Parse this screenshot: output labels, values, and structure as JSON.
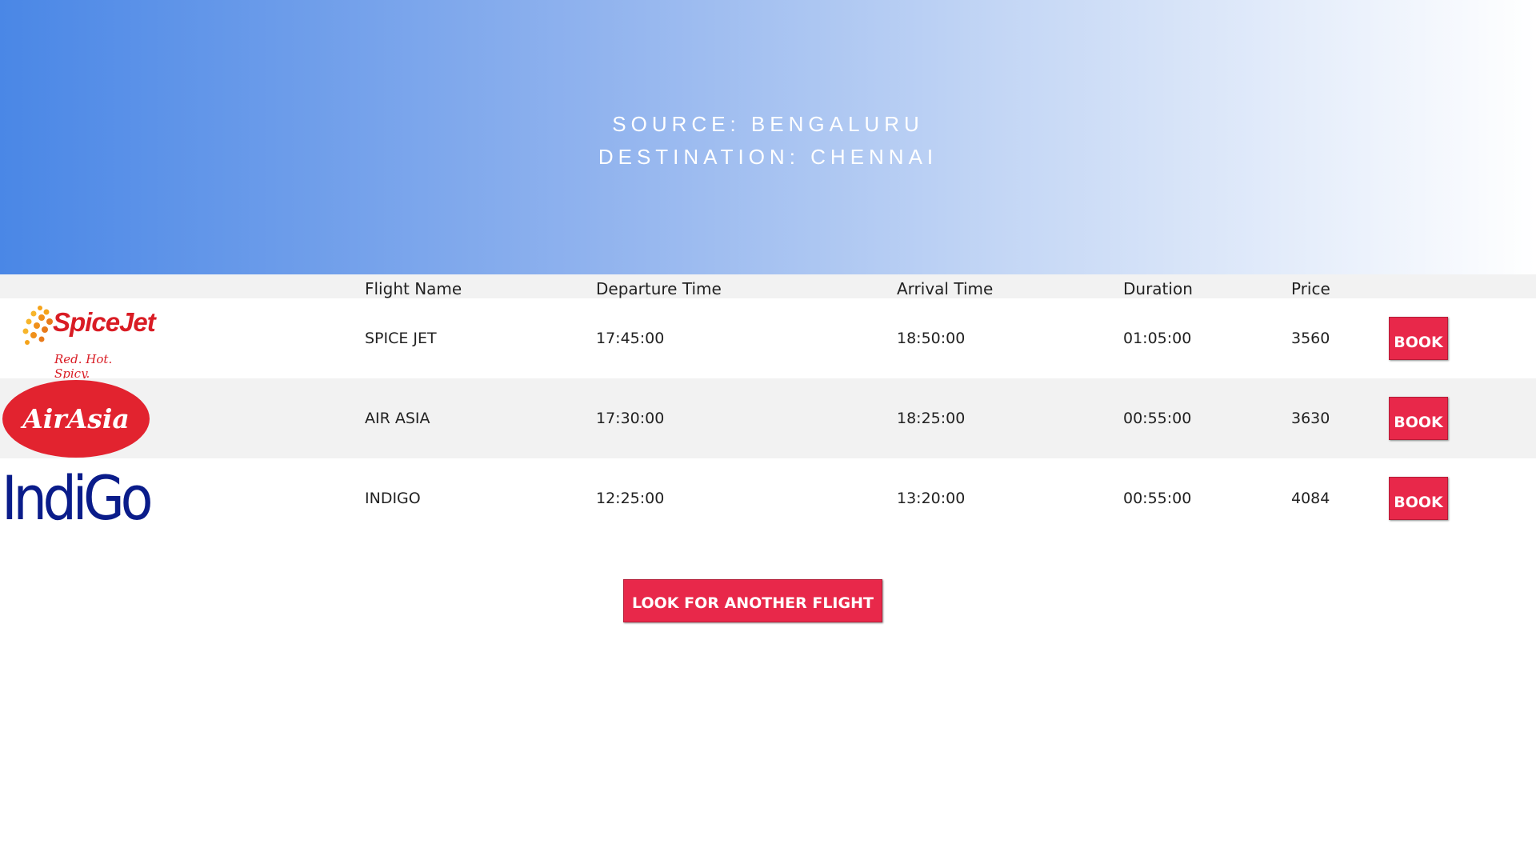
{
  "header": {
    "source_line": "SOURCE: BENGALURU",
    "destination_line": "DESTINATION: CHENNAI",
    "gradient_start": "#4a87e6",
    "gradient_end": "#ffffff"
  },
  "table": {
    "columns": [
      "",
      "Flight Name",
      "Departure Time",
      "Arrival Time",
      "Duration",
      "Price",
      ""
    ],
    "rows": [
      {
        "logo": {
          "name": "spicejet-logo",
          "word": "SpiceJet",
          "tagline": "Red. Hot. Spicy."
        },
        "flight_name": "SPICE JET",
        "departure": "17:45:00",
        "arrival": "18:50:00",
        "duration": "01:05:00",
        "price": "3560",
        "book_label": "BOOK"
      },
      {
        "logo": {
          "name": "airasia-logo",
          "word": "AirAsia"
        },
        "flight_name": "AIR ASIA",
        "departure": "17:30:00",
        "arrival": "18:25:00",
        "duration": "00:55:00",
        "price": "3630",
        "book_label": "BOOK"
      },
      {
        "logo": {
          "name": "indigo-logo",
          "word": "IndiGo"
        },
        "flight_name": "INDIGO",
        "departure": "12:25:00",
        "arrival": "13:20:00",
        "duration": "00:55:00",
        "price": "4084",
        "book_label": "BOOK"
      }
    ]
  },
  "footer": {
    "another_flight_label": "LOOK FOR ANOTHER FLIGHT"
  },
  "colors": {
    "accent_button": "#e8284a",
    "row_stripe": "#f2f2f2",
    "spicejet_red": "#d91c24",
    "airasia_red": "#e2232f",
    "indigo_blue": "#0a1c8a"
  }
}
